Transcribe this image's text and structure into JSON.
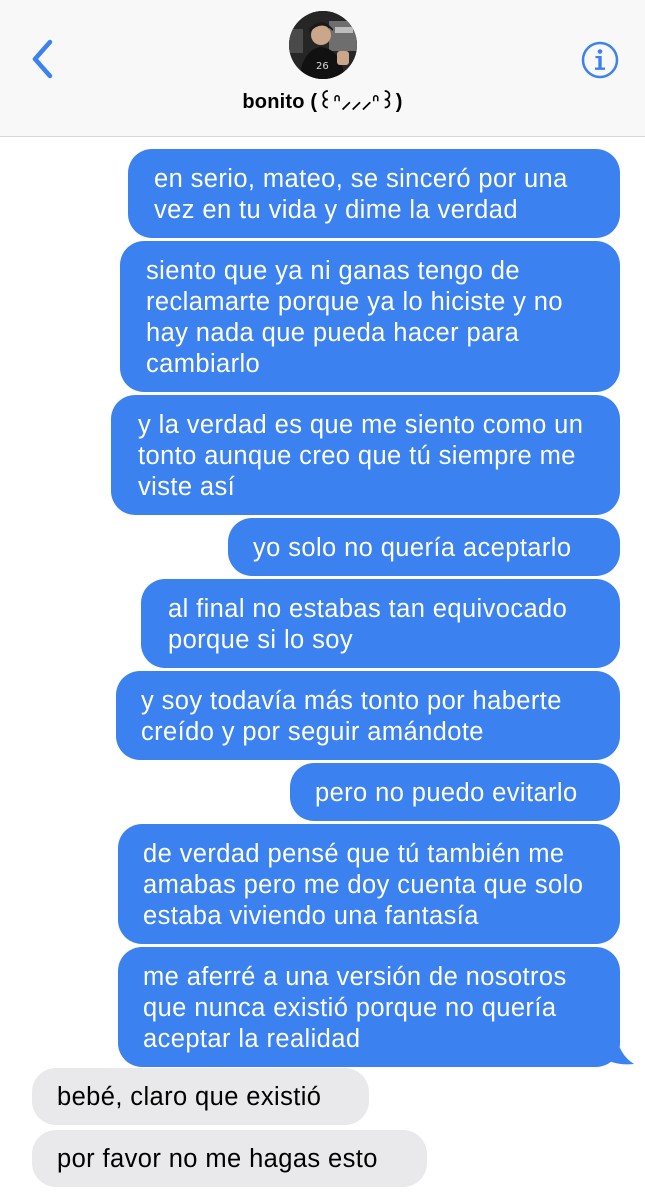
{
  "header": {
    "contact_name": "bonito (꒰ᐢ⸝⸝⸝ᐢ꒱)",
    "back_icon": "chevron-left-icon",
    "info_icon": "info-circle-icon",
    "accent_color": "#3b82f0"
  },
  "messages": [
    {
      "from": "me",
      "text": "en serio, mateo, se sinceró por una vez en tu vida y dime la verdad"
    },
    {
      "from": "me",
      "text": "siento que ya ni ganas tengo de reclamarte porque ya lo hiciste y no hay nada que pueda hacer para cambiarlo"
    },
    {
      "from": "me",
      "text": "y la verdad es que me siento como un tonto aunque creo que tú siempre me viste así"
    },
    {
      "from": "me",
      "text": "yo solo no quería aceptarlo"
    },
    {
      "from": "me",
      "text": "al final no estabas tan equivocado porque si lo soy"
    },
    {
      "from": "me",
      "text": "y soy todavía más tonto por haberte creído y por seguir amándote"
    },
    {
      "from": "me",
      "text": "pero no puedo evitarlo"
    },
    {
      "from": "me",
      "text": "de verdad pensé que tú también me amabas pero me doy cuenta que solo estaba viviendo una fantasía"
    },
    {
      "from": "me",
      "text": "me aferré a una versión de nosotros que nunca existió porque no quería aceptar la realidad"
    },
    {
      "from": "them",
      "text": "bebé, claro que existió"
    },
    {
      "from": "them",
      "text": "por favor no me hagas esto"
    }
  ]
}
